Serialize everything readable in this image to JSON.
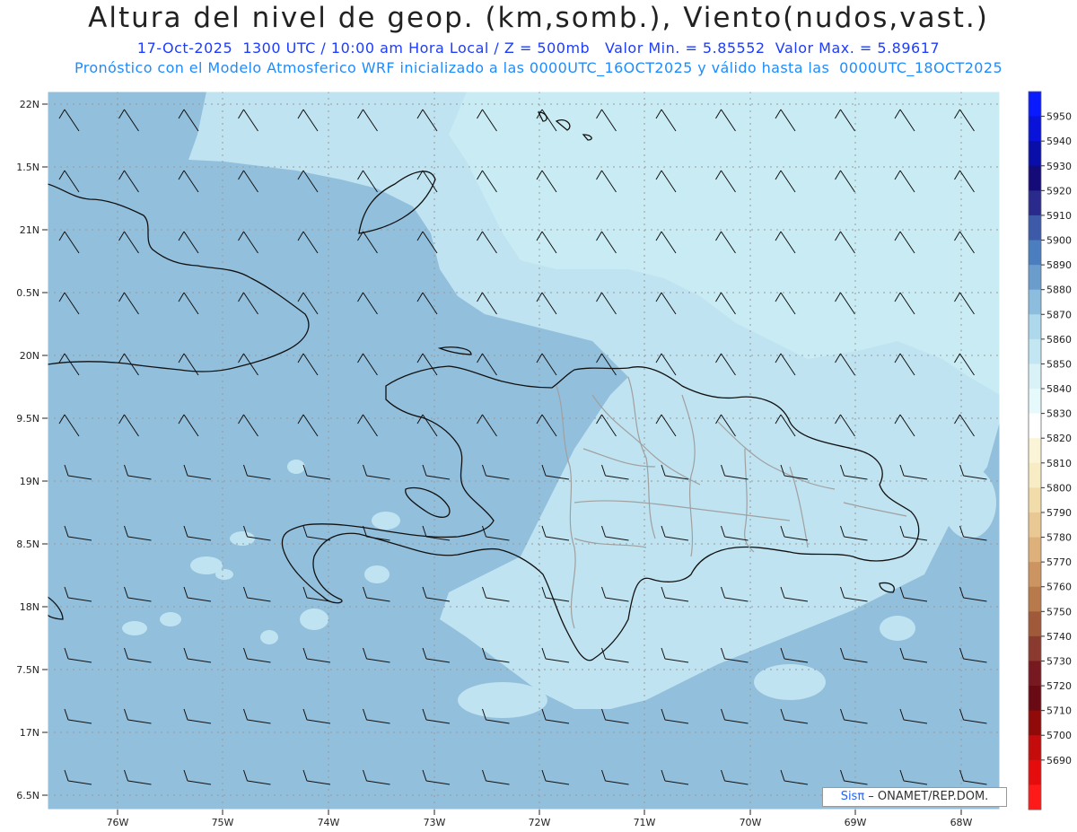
{
  "header": {
    "title": "Altura del nivel de geop. (km,somb.), Viento(nudos,vast.)",
    "subtitle_1": "17-Oct-2025  1300 UTC / 10:00 am Hora Local / Z = 500mb   Valor Min. = 5.85552  Valor Max. = 5.89617",
    "subtitle_2": "Pronóstico con el Modelo Atmosferico WRF inicializado a las 0000UTC_16OCT2025 y válido hasta las  0000UTC_18OCT2025"
  },
  "map": {
    "lat_ticks": [
      "22N",
      "1.5N",
      "21N",
      "0.5N",
      "20N",
      "9.5N",
      "19N",
      "8.5N",
      "18N",
      "7.5N",
      "17N",
      "6.5N"
    ],
    "lon_ticks": [
      "76W",
      "75W",
      "74W",
      "73W",
      "72W",
      "71W",
      "70W",
      "69W",
      "68W"
    ],
    "colors": {
      "field_dark": "#92bfdc",
      "field_light": "#bfe3f0",
      "field_lighter": "#c9ecf4",
      "coast": "#111111",
      "provinces": "#a0a0a0",
      "grid": "#9a9a9a"
    }
  },
  "colorbar": {
    "labels": [
      "5950",
      "5940",
      "5930",
      "5920",
      "5910",
      "5900",
      "5890",
      "5880",
      "5870",
      "5860",
      "5850",
      "5840",
      "5830",
      "5820",
      "5810",
      "5800",
      "5790",
      "5780",
      "5770",
      "5760",
      "5750",
      "5740",
      "5730",
      "5720",
      "5710",
      "5700",
      "5690"
    ],
    "colors": [
      "#0a1aff",
      "#0812d8",
      "#0a0ea8",
      "#140a78",
      "#2a2a8c",
      "#3c5aa8",
      "#4a7ebe",
      "#6a9ccc",
      "#8cbcde",
      "#aed8ec",
      "#c2e6f2",
      "#d8f2f8",
      "#e6fafc",
      "#ffffff",
      "#fcf4d6",
      "#f8ecc4",
      "#f2dcaa",
      "#eac894",
      "#deb07a",
      "#cc9460",
      "#b87a4a",
      "#a05a3a",
      "#8a3a2e",
      "#781820",
      "#6a0a14",
      "#900a0a",
      "#c40c0c",
      "#e40c0c",
      "#ff1a1a"
    ]
  },
  "credit": {
    "brand": "Sisπ",
    "text": " – ONAMET/REP.DOM."
  }
}
